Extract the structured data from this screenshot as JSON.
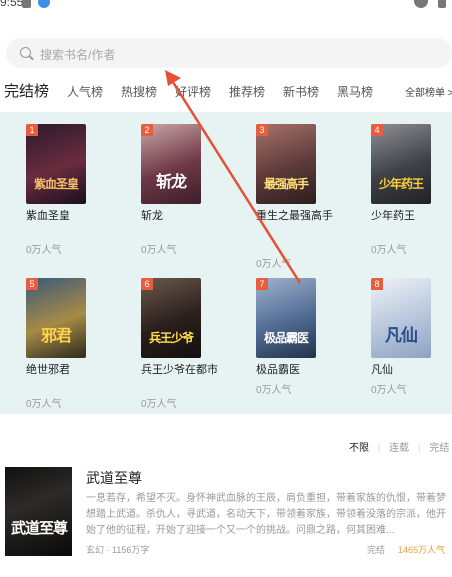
{
  "status_bar": {
    "time": "9:55"
  },
  "search": {
    "placeholder": "搜索书名/作者",
    "icon": "search-icon"
  },
  "tabs": [
    {
      "label": "完结榜",
      "active": true
    },
    {
      "label": "人气榜"
    },
    {
      "label": "热搜榜"
    },
    {
      "label": "好评榜"
    },
    {
      "label": "推荐榜"
    },
    {
      "label": "新书榜"
    },
    {
      "label": "黑马榜"
    }
  ],
  "all_rank_label": "全部榜单 >",
  "books": [
    {
      "rank": "1",
      "title": "紫血圣皇",
      "popularity": "0万人气",
      "cover_text": "紫血圣皇",
      "cover_color": "#3a1f3e"
    },
    {
      "rank": "2",
      "title": "斩龙",
      "popularity": "0万人气",
      "cover_text": "斩龙",
      "cover_color": "#7a4a56"
    },
    {
      "rank": "3",
      "title": "重生之最强高手",
      "popularity": "0万人气",
      "cover_text": "最强高手",
      "cover_color": "#8d5a5a"
    },
    {
      "rank": "4",
      "title": "少年药王",
      "popularity": "0万人气",
      "cover_text": "少年药王",
      "cover_color": "#5b5f66"
    },
    {
      "rank": "5",
      "title": "绝世邪君",
      "popularity": "0万人气",
      "cover_text": "邪君",
      "cover_color": "#6b5a3a"
    },
    {
      "rank": "6",
      "title": "兵王少爷在都市",
      "popularity": "0万人气",
      "cover_text": "兵王少爷",
      "cover_color": "#4a3b36"
    },
    {
      "rank": "7",
      "title": "极品霸医",
      "popularity": "0万人气",
      "cover_text": "极品霸医",
      "cover_color": "#5a7398"
    },
    {
      "rank": "8",
      "title": "凡仙",
      "popularity": "0万人气",
      "cover_text": "凡仙",
      "cover_color": "#c7d5e6"
    }
  ],
  "filters": {
    "all": "不限",
    "ongoing": "连载",
    "finished": "完结"
  },
  "featured": {
    "title": "武道至尊",
    "cover_text": "武道至尊",
    "description": "一息若存，希望不灭。身怀神武血脉的王辰，肩负重担，带着家族的仇恨，带着梦想踏上武道。杀仇人，寻武道，名动天下，带领着家族，带领着没落的宗派，他开始了他的征程，开始了迎接一个又一个的挑战。问鼎之路，何其困难...",
    "meta": "玄幻 · 1156万字",
    "status": "完结",
    "popularity": "1465万人气"
  },
  "colors": {
    "accent_red": "#e85c3f",
    "panel_bg": "#e6f3f2",
    "popularity_orange": "#e8a23a",
    "annotation_arrow": "#e35235"
  }
}
